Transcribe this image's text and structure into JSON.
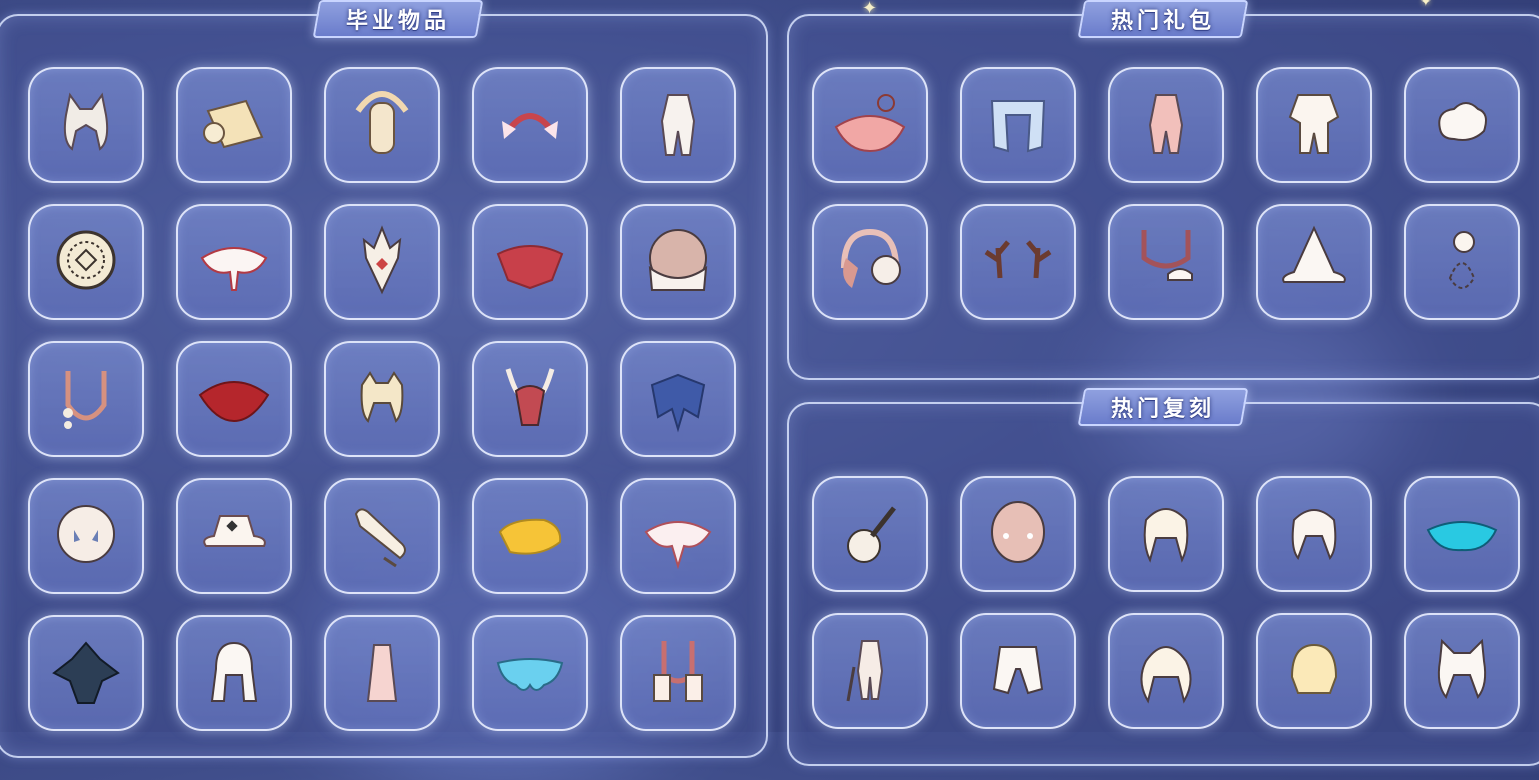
{
  "panels": {
    "graduation": {
      "title": "毕业物品"
    },
    "hot_packs": {
      "title": "热门礼包"
    },
    "hot_rerun": {
      "title": "热门复刻"
    }
  },
  "graduation_items": [
    "hair-cat-ears-icon",
    "scroll-drum-icon",
    "crescent-mask-icon",
    "winged-headband-icon",
    "white-outfit-icon",
    "round-medallion-icon",
    "white-cape-icon",
    "feather-mask-icon",
    "red-feather-cape-icon",
    "hood-mask-icon",
    "bead-necklace-icon",
    "red-cape-icon",
    "blonde-hair-icon",
    "red-horned-mask-icon",
    "blue-cape-icon",
    "owl-mask-icon",
    "white-hat-icon",
    "horn-instrument-icon",
    "yellow-cape-icon",
    "flower-cape-icon",
    "dark-armor-cape-icon",
    "white-hood-icon",
    "pink-dress-icon",
    "blue-butterfly-cape-icon",
    "pink-shawl-icon"
  ],
  "hot_pack_items": [
    "pink-cape-necklace-icon",
    "blue-scarf-icon",
    "pink-outfit-icon",
    "white-kimono-icon",
    "cloud-prop-icon",
    "headphones-icon",
    "antlers-icon",
    "necklace-jellyfish-icon",
    "witch-hat-icon",
    "cat-balloon-icon"
  ],
  "hot_rerun_items": [
    "guitar-icon",
    "blush-mask-icon",
    "twin-tail-hair-icon",
    "ponytail-hair-icon",
    "cyan-cape-icon",
    "outfit-with-cane-icon",
    "white-pants-icon",
    "curly-hair-icon",
    "short-hair-icon",
    "cat-ear-hair-icon"
  ]
}
